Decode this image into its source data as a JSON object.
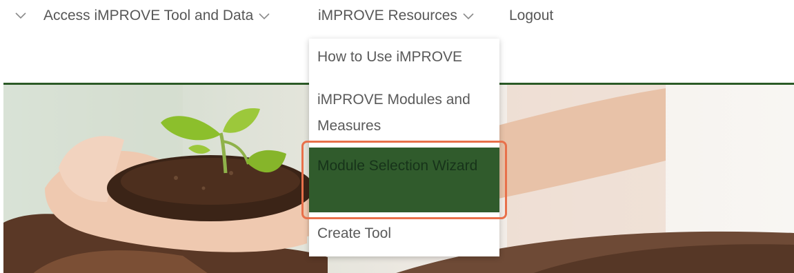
{
  "nav": {
    "access_label": "Access iMPROVE Tool and Data",
    "resources_label": "iMPROVE Resources",
    "logout_label": "Logout"
  },
  "dropdown": {
    "items": [
      {
        "label": "How to Use iMPROVE"
      },
      {
        "label": "iMPROVE Modules and Measures"
      },
      {
        "label": "Module Selection Wizard"
      },
      {
        "label": "Create Tool"
      }
    ],
    "highlighted_item": "Module Selection Wizard"
  },
  "colors": {
    "brand_green": "#2b5a26",
    "selected_bg": "#305b2c",
    "annotation_outline": "#e8704a"
  },
  "icons": {
    "nav_chevron": "chevron-down-icon"
  }
}
